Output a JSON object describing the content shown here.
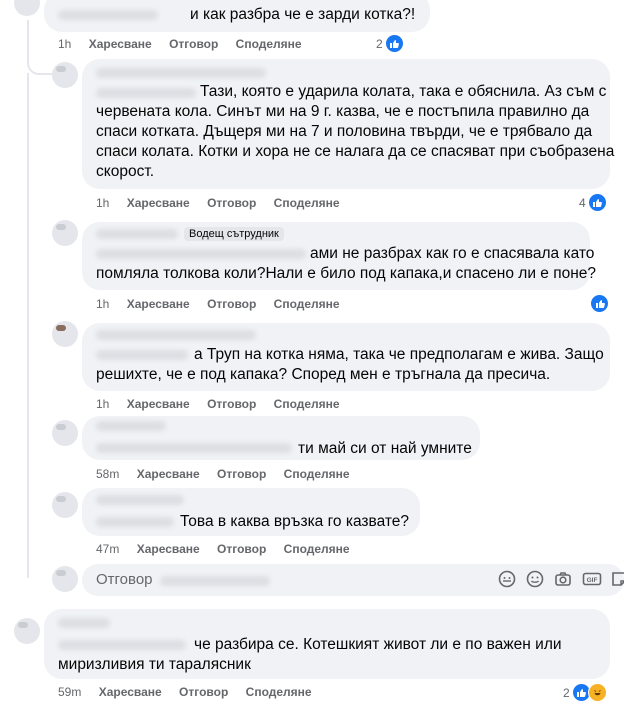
{
  "actions": {
    "like": "Харесване",
    "reply": "Отговор",
    "share": "Споделяне"
  },
  "comments": [
    {
      "text": "и как разбра че е зарди котка?!",
      "time": "1h",
      "reactions": "2"
    },
    {
      "text_lines": [
        "Тази, която е ударила колата, така е обяснила. Аз съм с",
        "червената кола. Синът ми на 9 г. казва, че е постъпила правилно да",
        "спаси котката. Дъщеря ми на 7 и половина твърди, че е трябвало да",
        "спаси колата. Котки и хора не се налага да се спасяват при съобразена",
        "скорост."
      ],
      "time": "1h",
      "reactions": "4"
    },
    {
      "badge": "Водещ сътрудник",
      "text_lines": [
        "ами не разбрах как го е спасявала като",
        "помляла толкова коли?Нали е било под капака,и спасено ли е поне?"
      ],
      "time": "1h",
      "reactions": ""
    },
    {
      "text_lines": [
        "а Труп на котка няма, така че предполагам е жива. Защо",
        "решихте, че е под капака? Според мен е тръгнала да пресича."
      ],
      "time": "1h",
      "reactions": ""
    },
    {
      "text": "ти май си от най умните",
      "time": "58m"
    },
    {
      "text": "Това в каква връзка го казвате?",
      "time": "47m"
    },
    {
      "text_lines": [
        "че разбира се. Котешкият живот ли е по важен или",
        "миризливия ти таралясник"
      ],
      "time": "59m",
      "reactions": "2"
    }
  ],
  "reply_box": {
    "placeholder": "Отговор"
  },
  "icons": {
    "like": "thumbs-up-icon",
    "haha": "laughing-emoji-icon",
    "avatar": "avatar",
    "sticker": "sticker-icon",
    "emoji": "emoji-icon",
    "camera": "camera-icon",
    "gif": "gif-icon",
    "sticker2": "sticker-square-icon"
  },
  "colors": {
    "accent": "#1877f2",
    "bubble": "#f0f2f5",
    "meta": "#65676b"
  }
}
